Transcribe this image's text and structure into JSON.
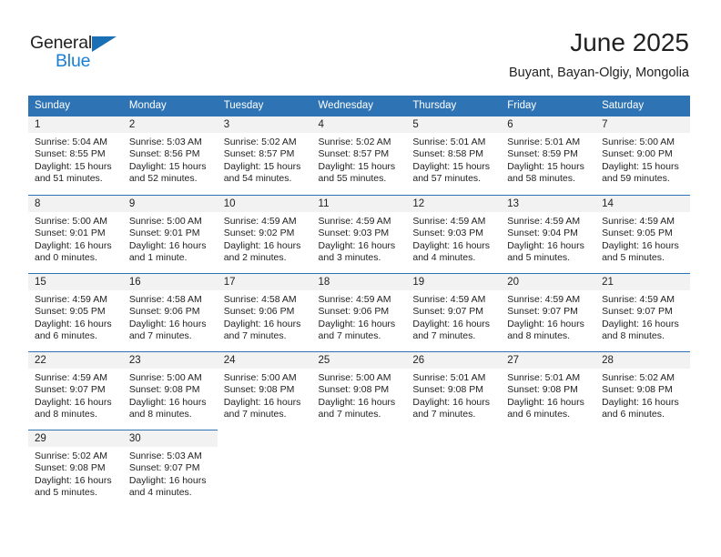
{
  "logo": {
    "word_top": "General",
    "word_bottom": "Blue",
    "triangle_color": "#1a6fb5",
    "blue_color": "#1a7fd4"
  },
  "header": {
    "title": "June 2025",
    "location": "Buyant, Bayan-Olgiy, Mongolia"
  },
  "colors": {
    "header_blue": "#2e74b5",
    "daynum_gray": "#f2f2f2",
    "text": "#222222"
  },
  "weekday_headers": [
    "Sunday",
    "Monday",
    "Tuesday",
    "Wednesday",
    "Thursday",
    "Friday",
    "Saturday"
  ],
  "weeks": [
    [
      {
        "day": "1",
        "sunrise": "Sunrise: 5:04 AM",
        "sunset": "Sunset: 8:55 PM",
        "daylight_1": "Daylight: 15 hours",
        "daylight_2": "and 51 minutes."
      },
      {
        "day": "2",
        "sunrise": "Sunrise: 5:03 AM",
        "sunset": "Sunset: 8:56 PM",
        "daylight_1": "Daylight: 15 hours",
        "daylight_2": "and 52 minutes."
      },
      {
        "day": "3",
        "sunrise": "Sunrise: 5:02 AM",
        "sunset": "Sunset: 8:57 PM",
        "daylight_1": "Daylight: 15 hours",
        "daylight_2": "and 54 minutes."
      },
      {
        "day": "4",
        "sunrise": "Sunrise: 5:02 AM",
        "sunset": "Sunset: 8:57 PM",
        "daylight_1": "Daylight: 15 hours",
        "daylight_2": "and 55 minutes."
      },
      {
        "day": "5",
        "sunrise": "Sunrise: 5:01 AM",
        "sunset": "Sunset: 8:58 PM",
        "daylight_1": "Daylight: 15 hours",
        "daylight_2": "and 57 minutes."
      },
      {
        "day": "6",
        "sunrise": "Sunrise: 5:01 AM",
        "sunset": "Sunset: 8:59 PM",
        "daylight_1": "Daylight: 15 hours",
        "daylight_2": "and 58 minutes."
      },
      {
        "day": "7",
        "sunrise": "Sunrise: 5:00 AM",
        "sunset": "Sunset: 9:00 PM",
        "daylight_1": "Daylight: 15 hours",
        "daylight_2": "and 59 minutes."
      }
    ],
    [
      {
        "day": "8",
        "sunrise": "Sunrise: 5:00 AM",
        "sunset": "Sunset: 9:01 PM",
        "daylight_1": "Daylight: 16 hours",
        "daylight_2": "and 0 minutes."
      },
      {
        "day": "9",
        "sunrise": "Sunrise: 5:00 AM",
        "sunset": "Sunset: 9:01 PM",
        "daylight_1": "Daylight: 16 hours",
        "daylight_2": "and 1 minute."
      },
      {
        "day": "10",
        "sunrise": "Sunrise: 4:59 AM",
        "sunset": "Sunset: 9:02 PM",
        "daylight_1": "Daylight: 16 hours",
        "daylight_2": "and 2 minutes."
      },
      {
        "day": "11",
        "sunrise": "Sunrise: 4:59 AM",
        "sunset": "Sunset: 9:03 PM",
        "daylight_1": "Daylight: 16 hours",
        "daylight_2": "and 3 minutes."
      },
      {
        "day": "12",
        "sunrise": "Sunrise: 4:59 AM",
        "sunset": "Sunset: 9:03 PM",
        "daylight_1": "Daylight: 16 hours",
        "daylight_2": "and 4 minutes."
      },
      {
        "day": "13",
        "sunrise": "Sunrise: 4:59 AM",
        "sunset": "Sunset: 9:04 PM",
        "daylight_1": "Daylight: 16 hours",
        "daylight_2": "and 5 minutes."
      },
      {
        "day": "14",
        "sunrise": "Sunrise: 4:59 AM",
        "sunset": "Sunset: 9:05 PM",
        "daylight_1": "Daylight: 16 hours",
        "daylight_2": "and 5 minutes."
      }
    ],
    [
      {
        "day": "15",
        "sunrise": "Sunrise: 4:59 AM",
        "sunset": "Sunset: 9:05 PM",
        "daylight_1": "Daylight: 16 hours",
        "daylight_2": "and 6 minutes."
      },
      {
        "day": "16",
        "sunrise": "Sunrise: 4:58 AM",
        "sunset": "Sunset: 9:06 PM",
        "daylight_1": "Daylight: 16 hours",
        "daylight_2": "and 7 minutes."
      },
      {
        "day": "17",
        "sunrise": "Sunrise: 4:58 AM",
        "sunset": "Sunset: 9:06 PM",
        "daylight_1": "Daylight: 16 hours",
        "daylight_2": "and 7 minutes."
      },
      {
        "day": "18",
        "sunrise": "Sunrise: 4:59 AM",
        "sunset": "Sunset: 9:06 PM",
        "daylight_1": "Daylight: 16 hours",
        "daylight_2": "and 7 minutes."
      },
      {
        "day": "19",
        "sunrise": "Sunrise: 4:59 AM",
        "sunset": "Sunset: 9:07 PM",
        "daylight_1": "Daylight: 16 hours",
        "daylight_2": "and 7 minutes."
      },
      {
        "day": "20",
        "sunrise": "Sunrise: 4:59 AM",
        "sunset": "Sunset: 9:07 PM",
        "daylight_1": "Daylight: 16 hours",
        "daylight_2": "and 8 minutes."
      },
      {
        "day": "21",
        "sunrise": "Sunrise: 4:59 AM",
        "sunset": "Sunset: 9:07 PM",
        "daylight_1": "Daylight: 16 hours",
        "daylight_2": "and 8 minutes."
      }
    ],
    [
      {
        "day": "22",
        "sunrise": "Sunrise: 4:59 AM",
        "sunset": "Sunset: 9:07 PM",
        "daylight_1": "Daylight: 16 hours",
        "daylight_2": "and 8 minutes."
      },
      {
        "day": "23",
        "sunrise": "Sunrise: 5:00 AM",
        "sunset": "Sunset: 9:08 PM",
        "daylight_1": "Daylight: 16 hours",
        "daylight_2": "and 8 minutes."
      },
      {
        "day": "24",
        "sunrise": "Sunrise: 5:00 AM",
        "sunset": "Sunset: 9:08 PM",
        "daylight_1": "Daylight: 16 hours",
        "daylight_2": "and 7 minutes."
      },
      {
        "day": "25",
        "sunrise": "Sunrise: 5:00 AM",
        "sunset": "Sunset: 9:08 PM",
        "daylight_1": "Daylight: 16 hours",
        "daylight_2": "and 7 minutes."
      },
      {
        "day": "26",
        "sunrise": "Sunrise: 5:01 AM",
        "sunset": "Sunset: 9:08 PM",
        "daylight_1": "Daylight: 16 hours",
        "daylight_2": "and 7 minutes."
      },
      {
        "day": "27",
        "sunrise": "Sunrise: 5:01 AM",
        "sunset": "Sunset: 9:08 PM",
        "daylight_1": "Daylight: 16 hours",
        "daylight_2": "and 6 minutes."
      },
      {
        "day": "28",
        "sunrise": "Sunrise: 5:02 AM",
        "sunset": "Sunset: 9:08 PM",
        "daylight_1": "Daylight: 16 hours",
        "daylight_2": "and 6 minutes."
      }
    ],
    [
      {
        "day": "29",
        "sunrise": "Sunrise: 5:02 AM",
        "sunset": "Sunset: 9:08 PM",
        "daylight_1": "Daylight: 16 hours",
        "daylight_2": "and 5 minutes."
      },
      {
        "day": "30",
        "sunrise": "Sunrise: 5:03 AM",
        "sunset": "Sunset: 9:07 PM",
        "daylight_1": "Daylight: 16 hours",
        "daylight_2": "and 4 minutes."
      },
      {
        "day": "",
        "sunrise": "",
        "sunset": "",
        "daylight_1": "",
        "daylight_2": ""
      },
      {
        "day": "",
        "sunrise": "",
        "sunset": "",
        "daylight_1": "",
        "daylight_2": ""
      },
      {
        "day": "",
        "sunrise": "",
        "sunset": "",
        "daylight_1": "",
        "daylight_2": ""
      },
      {
        "day": "",
        "sunrise": "",
        "sunset": "",
        "daylight_1": "",
        "daylight_2": ""
      },
      {
        "day": "",
        "sunrise": "",
        "sunset": "",
        "daylight_1": "",
        "daylight_2": ""
      }
    ]
  ]
}
